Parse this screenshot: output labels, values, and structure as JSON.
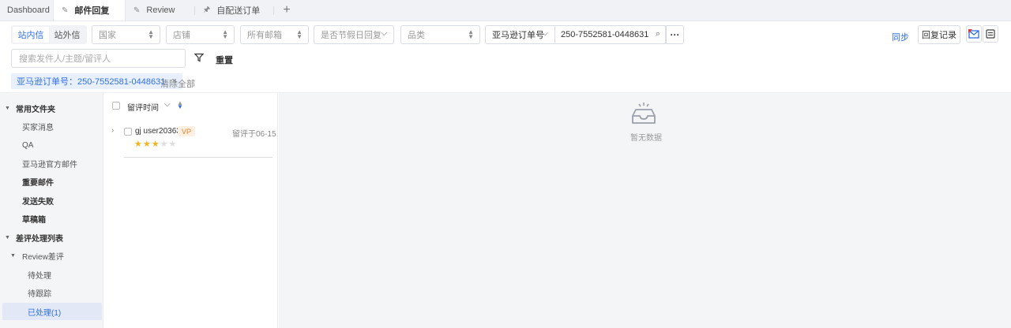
{
  "tabs": [
    {
      "label": "Dashboard",
      "pinned": false,
      "active": false
    },
    {
      "label": "邮件回复",
      "pinned": true,
      "active": true
    },
    {
      "label": "Review",
      "pinned": true,
      "active": false
    },
    {
      "label": "自配送订单",
      "pinned": true,
      "active": false
    }
  ],
  "tab_add": "+",
  "filters": {
    "segment": [
      "站内信",
      "站外信"
    ],
    "country": "国家",
    "store": "店铺",
    "mailbox": "所有邮箱",
    "holiday": "是否节假日回复",
    "category": "品类",
    "search_type": "亚马逊订单号",
    "search_value": "250-7552581-0448631",
    "more": "···",
    "sync": "同步",
    "reply_record": "回复记录",
    "search_placeholder": "搜索发件人/主题/留评人",
    "reset": "重置",
    "chip": "亚马逊订单号：250-7552581-0448631",
    "chip_close": "×",
    "clear_all": "清除全部"
  },
  "sidebar": {
    "items": [
      {
        "label": "常用文件夹",
        "bold": true,
        "expander": "▼"
      },
      {
        "label": "买家消息"
      },
      {
        "label": "QA"
      },
      {
        "label": "亚马逊官方邮件"
      },
      {
        "label": "重要邮件",
        "bold": true
      },
      {
        "label": "发送失败",
        "bold": true
      },
      {
        "label": "草稿箱",
        "bold": true
      },
      {
        "label": "差评处理列表",
        "bold": true,
        "expander": "▼"
      },
      {
        "label": "Review差评",
        "expander": "▼"
      },
      {
        "label": "待处理"
      },
      {
        "label": "待跟踪"
      },
      {
        "label": "已处理(1)",
        "selected": true
      }
    ]
  },
  "list": {
    "sort_label": "留评时间",
    "rows": [
      {
        "name": "gj user20363",
        "badge": "VP",
        "time": "留评于06-15",
        "rating": 3,
        "max_rating": 5
      }
    ]
  },
  "detail": {
    "empty_text": "暂无数据"
  },
  "colors": {
    "accent": "#2f6fe0",
    "star": "#f6b21a",
    "badge_bg": "#fdf0e3",
    "badge_fg": "#e38428"
  }
}
